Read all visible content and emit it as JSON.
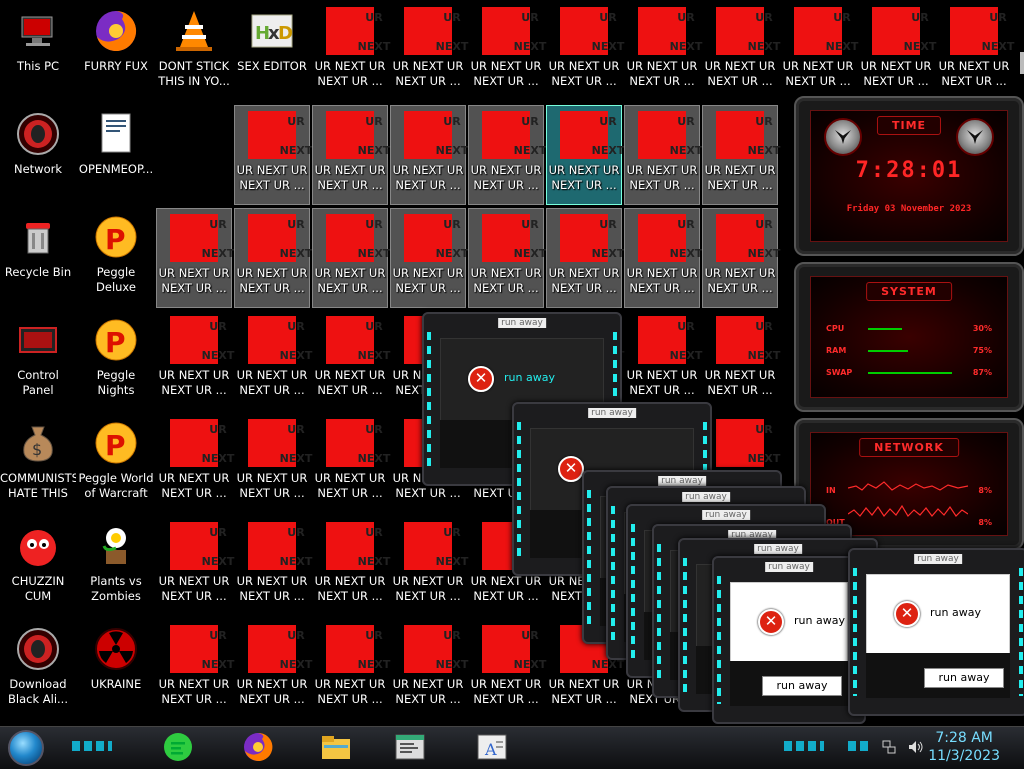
{
  "desktop": {
    "col1": [
      {
        "label": "This PC",
        "icon": "computer-icon"
      },
      {
        "label": "Network",
        "icon": "alien-orb-icon"
      },
      {
        "label": "Recycle Bin",
        "icon": "recycle-bin-icon"
      },
      {
        "label": "Control Panel",
        "icon": "control-panel-icon"
      },
      {
        "label": "COMMUNISTS\nHATE THIS G...",
        "icon": "money-bag-icon"
      },
      {
        "label": "CHUZZIN\nCUM",
        "icon": "chuzzle-icon"
      },
      {
        "label": "Download\nBlack Ali...",
        "icon": "alien-orb-icon"
      }
    ],
    "col2": [
      {
        "label": "FURRY FUX",
        "icon": "firefox-icon"
      },
      {
        "label": "OPENMEOP...",
        "icon": "document-icon"
      },
      {
        "label": "Peggle Deluxe",
        "icon": "peggle-icon"
      },
      {
        "label": "Peggle Nights\nDeluxe",
        "icon": "peggle-icon"
      },
      {
        "label": "Peggle World\nof Warcraft",
        "icon": "peggle-icon"
      },
      {
        "label": "Plants vs\nZombies",
        "icon": "plant-icon"
      },
      {
        "label": "UKRAINE",
        "icon": "radiation-icon"
      }
    ],
    "row1_extra": [
      {
        "label": "DONT STICK\nTHIS IN YO...",
        "icon": "vlc-cone-icon"
      },
      {
        "label": "SEX EDITOR",
        "icon": "hxd-icon"
      }
    ],
    "ur_icon": {
      "top": "UR",
      "bottom": "NEXT",
      "label": "UR NEXT UR\nNEXT UR ..."
    }
  },
  "gadgets": {
    "time": {
      "title": "TIME",
      "clock": "7:28:01",
      "date": "Friday 03 November 2023"
    },
    "system": {
      "title": "SYSTEM",
      "rows": [
        {
          "key": "CPU",
          "value": "30%",
          "level": 0.3
        },
        {
          "key": "RAM",
          "value": "75%",
          "level": 0.75
        },
        {
          "key": "SWAP",
          "value": "87%",
          "level": 0.87
        }
      ]
    },
    "network": {
      "title": "NETWORK",
      "rows": [
        {
          "key": "IN",
          "value": "8%"
        },
        {
          "key": "OUT",
          "value": "8%"
        }
      ]
    }
  },
  "dialog": {
    "caption": "run away",
    "message": "run away",
    "button": "run away"
  },
  "taskbar": {
    "apps": [
      {
        "name": "notes-app-icon",
        "color": "#2ecc40"
      },
      {
        "name": "firefox-icon",
        "color": "#ff7a00"
      },
      {
        "name": "file-explorer-icon",
        "color": "#f4c542"
      },
      {
        "name": "document-window-icon",
        "color": "#dddddd"
      },
      {
        "name": "text-editor-icon",
        "color": "#dddddd"
      }
    ],
    "time": "7:28 AM",
    "date": "11/3/2023"
  },
  "colors": {
    "ur_red": "#ee1111",
    "gadget_red": "#ff2626",
    "dialog_light": "#22eeee",
    "clock": "#77ddff"
  }
}
